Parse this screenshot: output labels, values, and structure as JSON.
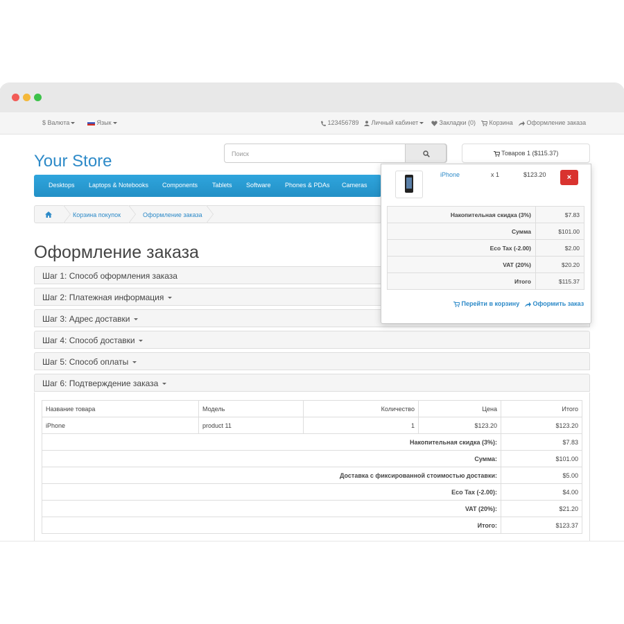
{
  "topbar": {
    "currency": "Валюта",
    "currency_symbol": "$",
    "language": "Язык",
    "phone": "123456789",
    "account": "Личный кабинет",
    "wishlist": "Закладки (0)",
    "cart": "Корзина",
    "checkout": "Оформление заказа"
  },
  "header": {
    "logo": "Your Store",
    "search_placeholder": "Поиск",
    "cart_button": "Товаров 1 ($115.37)"
  },
  "menu": [
    "Desktops",
    "Laptops & Notebooks",
    "Components",
    "Tablets",
    "Software",
    "Phones & PDAs",
    "Cameras"
  ],
  "breadcrumb": [
    "Корзина покупок",
    "Оформление заказа"
  ],
  "page_title": "Оформление заказа",
  "steps": [
    "Шаг 1: Способ оформления заказа",
    "Шаг 2: Платежная информация",
    "Шаг 3: Адрес доставки",
    "Шаг 4: Способ доставки",
    "Шаг 5: Способ оплаты",
    "Шаг 6: Подтверждение заказа"
  ],
  "order_table": {
    "headers": [
      "Название товара",
      "Модель",
      "Количество",
      "Цена",
      "Итого"
    ],
    "item": {
      "name": "iPhone",
      "model": "product 11",
      "qty": "1",
      "price": "$123.20",
      "total": "$123.20"
    },
    "totals": [
      {
        "label": "Накопительная скидка (3%):",
        "value": "$7.83"
      },
      {
        "label": "Сумма:",
        "value": "$101.00"
      },
      {
        "label": "Доставка с фиксированной стоимостью доставки:",
        "value": "$5.00"
      },
      {
        "label": "Eco Tax (-2.00):",
        "value": "$4.00"
      },
      {
        "label": "VAT (20%):",
        "value": "$21.20"
      },
      {
        "label": "Итого:",
        "value": "$123.37"
      }
    ]
  },
  "cart_dropdown": {
    "item": {
      "name": "iPhone",
      "qty": "x 1",
      "price": "$123.20",
      "remove": "×"
    },
    "totals": [
      {
        "label": "Накопительная скидка (3%)",
        "value": "$7.83"
      },
      {
        "label": "Сумма",
        "value": "$101.00"
      },
      {
        "label": "Eco Tax (-2.00)",
        "value": "$2.00"
      },
      {
        "label": "VAT (20%)",
        "value": "$20.20"
      },
      {
        "label": "Итого",
        "value": "$115.37"
      }
    ],
    "view_cart": "Перейти в корзину",
    "checkout": "Оформить заказ"
  },
  "colors": {
    "accent": "#2d8ac8",
    "menu": "#2a9bd3",
    "danger": "#d9332f"
  }
}
